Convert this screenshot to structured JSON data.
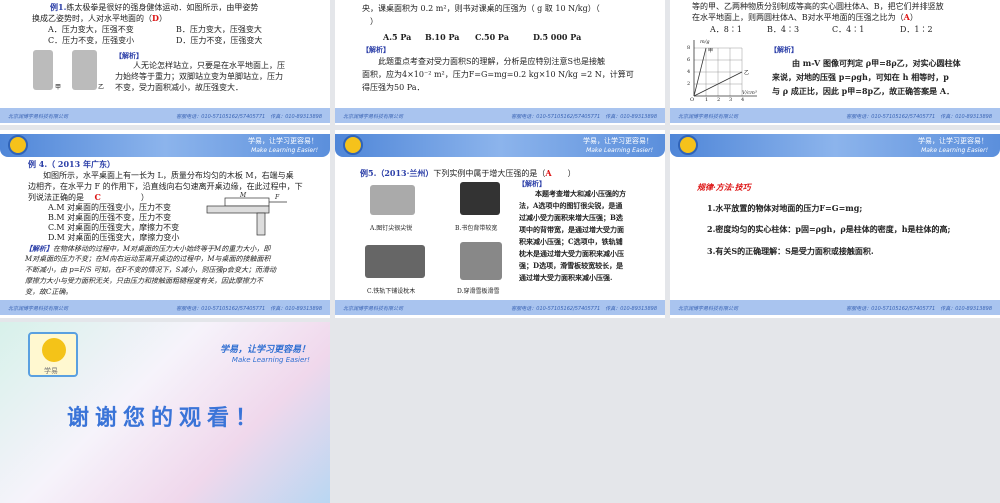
{
  "footer": {
    "company": "北京润博学易科技有限公司",
    "phone": "客服电话：010-57105162/57405771　传真：010-89313898"
  },
  "header": {
    "slogan_cn": "学易，让学习更容易！",
    "slogan_en": "Make Learning Easier!"
  },
  "slides": [
    {
      "q": "例1.",
      "q_text": "练太极拳是很好的强身健体运动．如图所示，由甲姿势",
      "q_line2": "换成乙姿势时，人对水平地面的（",
      "answer": "D",
      "close": "）",
      "options": [
        "A．压力变大，压强不变",
        "B．压力变大，压强变大",
        "C．压力不变，压强变小",
        "D．压力不变，压强变大"
      ],
      "jiexi": "【解析】",
      "analysis": [
        "人无论怎样站立，只要是在水平地面上，压",
        "力始终等于重力；双脚站立变为单脚站立，压力",
        "不变，受力面积减小，故压强变大．"
      ],
      "fig_labels": [
        "甲",
        "乙"
      ]
    },
    {
      "lines": [
        "央，课桌面积为 0.2 m²，则书对课桌的压强为（ g 取 10 N/kg）（",
        "）"
      ],
      "options": [
        "A.5 Pa",
        "B.10 Pa",
        "C.50 Pa",
        "D.5 000 Pa"
      ],
      "jiexi": "【解析】",
      "analysis": [
        "此题重点考查对受力面积S的理解，分析是应特别注意S也是接触",
        "面积，应为4×10⁻² m²，压力F=G=mg=0.2 kg×10 N/kg =2 N，计算可",
        "得压强为50 Pa．"
      ]
    },
    {
      "lines": [
        "等的甲、乙两种物质分别制成等高的实心圆柱体A、B，把它们并排竖放",
        "在水平地面上，则两圆柱体A、B对水平地面的压强之比为（"
      ],
      "answer": "A",
      "close": "）",
      "options": [
        "A．8∶1",
        "B．4∶3",
        "C．4∶1",
        "D．1∶2"
      ],
      "jiexi": "【解析】",
      "analysis": [
        "由 m-V 图像可判定 ρ甲=8ρ乙，对实心圆柱体",
        "来说，对地的压强 p=ρgh，可知在 h 相等时，p",
        "与 ρ 成正比，因此 p甲=8p乙，故正确答案是 A．"
      ],
      "graph": {
        "ylabel": "m/g",
        "xlabel": "V/cm³",
        "yticks": [
          "8",
          "6",
          "4",
          "2"
        ],
        "xticks": [
          "O",
          "1",
          "2",
          "3",
          "4"
        ],
        "series": [
          "甲",
          "乙"
        ]
      }
    },
    {
      "q": "例 4.（ 2013 年广东）",
      "lines": [
        "如图所示，水平桌面上有一长为 L，质量分布均匀的木板 M，右端与桌",
        "边相齐，在水平力 F 的作用下，沿直线向右匀速离开桌边缘，在此过程中，下",
        "列说法正确的是"
      ],
      "answer": "C",
      "close": "）",
      "options": [
        "A.M 对桌面的压强变小，压力不变",
        "B.M 对桌面的压强不变，压力不变",
        "C.M 对桌面的压强变大，摩擦力不变",
        "D.M 对桌面的压强变大，摩擦力变小"
      ],
      "fig_labels": [
        "M",
        "F"
      ],
      "jiexi": "【解析】",
      "analysis": [
        "在物体移动的过程中，M对桌面的压力大小始终等于M的重力大小，即",
        "M对桌面的压力不变；在M向右运动至离开桌边的过程中，M与桌面的接触面积",
        "不断减小，由 p=F/S 可知，在F不变的情况下，S减小，则压强p会变大；而滑动",
        "摩擦力大小与受力面积无关，只由压力和接触面粗糙程度有关，因此摩擦力不",
        "变，故C正确。"
      ]
    },
    {
      "q": "例5.（2013·兰州）",
      "q_text": "下列实例中属于增大压强的是（",
      "answer": "A",
      "close": "）",
      "captions": [
        "A.图钉尖很尖锐",
        "B.书包背带较宽",
        "C.铁轨下铺设枕木",
        "D.穿滑雪板滑雪"
      ],
      "jiexi": "【解析】",
      "analysis": [
        "本题考查增大和减小压强的方",
        "法，A选项中的图钉很尖锐，是通",
        "过减小受力面积来增大压强；B选",
        "项中的背带宽，是通过增大受力面",
        "积来减小压强；C选项中，铁轨铺",
        "枕木是通过增大受力面积来减小压",
        "强；D选项，滑雪板较宽较长，是",
        "通过增大受力面积来减小压强."
      ]
    },
    {
      "title": "规律·方法·技巧",
      "items": [
        "1.水平放置的物体对地面的压力F=G=mg;",
        "2.密度均匀的实心柱体：p固=ρgh，ρ是柱体的密度，h是柱体的高;",
        "3.有关S的正确理解：S是受力面积或接触面积."
      ]
    },
    {
      "title": "谢谢您的观看！",
      "slogan_cn": "学易，让学习更容易！",
      "slogan_en": "Make Learning Easier!",
      "logo_text": "学易"
    }
  ]
}
